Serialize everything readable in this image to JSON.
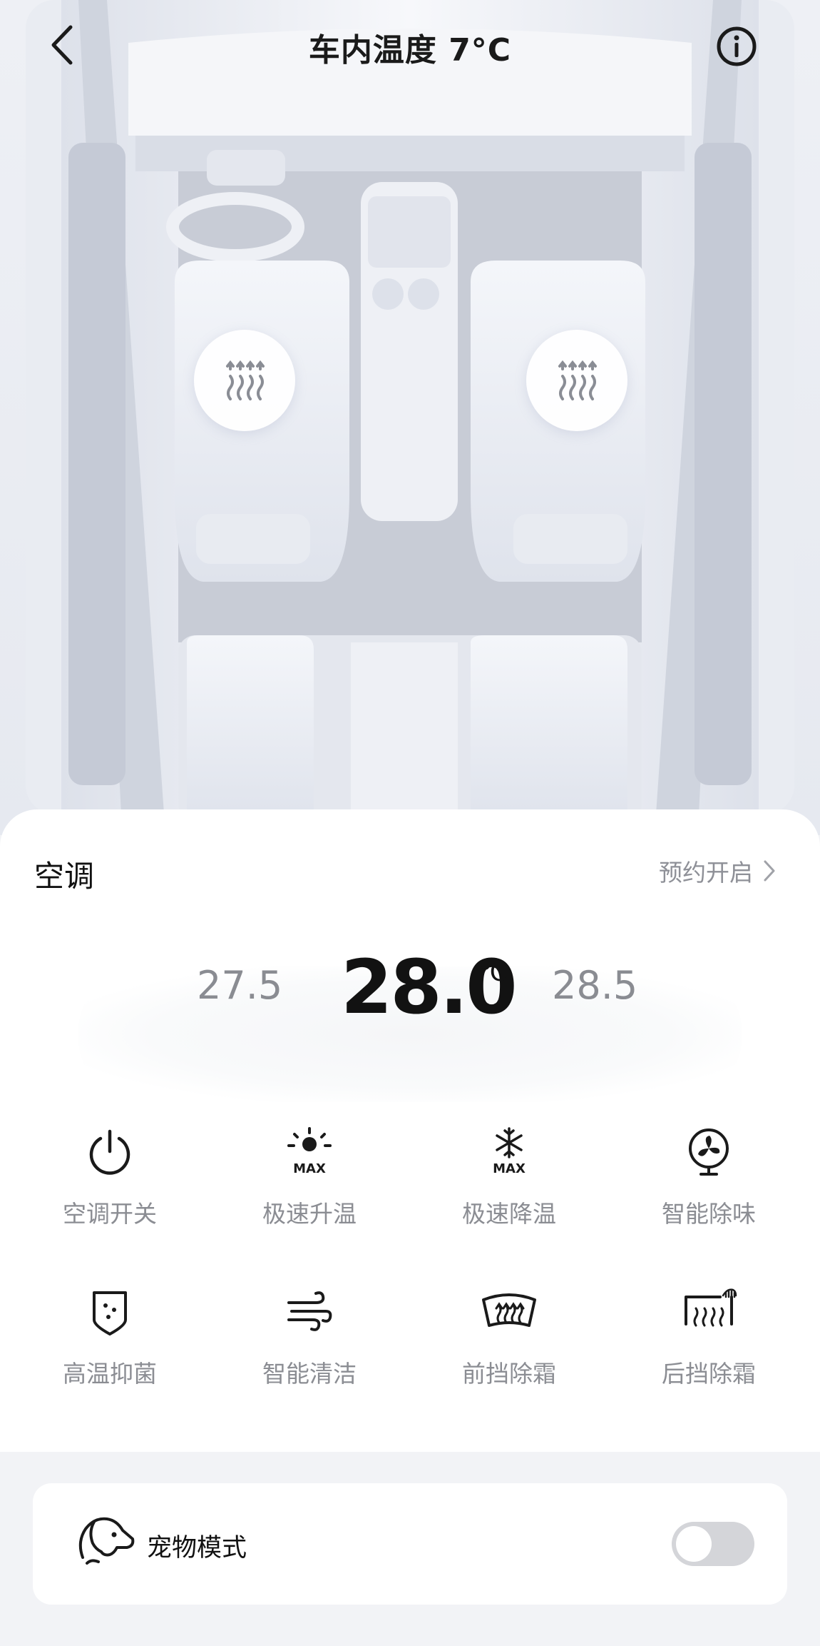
{
  "header": {
    "title": "车内温度 7°C"
  },
  "seat_heating": {
    "driver_icon": "seat-heat-icon",
    "passenger_icon": "seat-heat-icon"
  },
  "ac": {
    "title": "空调",
    "schedule_label": "预约开启",
    "temp_lower": "27.5",
    "temp_current": "28.0",
    "temp_unit": "℃",
    "temp_upper": "28.5",
    "controls": [
      {
        "label": "空调开关",
        "icon": "power-icon"
      },
      {
        "label": "极速升温",
        "icon": "max-heat-icon"
      },
      {
        "label": "极速降温",
        "icon": "max-cool-icon"
      },
      {
        "label": "智能除味",
        "icon": "fan-icon"
      },
      {
        "label": "高温抑菌",
        "icon": "shield-icon"
      },
      {
        "label": "智能清洁",
        "icon": "wind-icon"
      },
      {
        "label": "前挡除霜",
        "icon": "front-defrost-icon"
      },
      {
        "label": "后挡除霜",
        "icon": "rear-defrost-icon"
      }
    ]
  },
  "pet_mode": {
    "label": "宠物模式",
    "enabled": false
  },
  "colors": {
    "accent_text": "#121212",
    "muted_text": "#8b8d93",
    "page_bg": "#f2f3f6",
    "toggle_off": "#d4d5d9"
  }
}
